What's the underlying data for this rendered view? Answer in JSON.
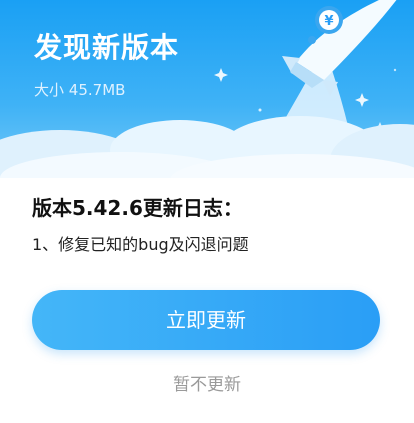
{
  "dialog": {
    "title": "发现新版本",
    "size_label": "大小",
    "size_value": "45.7MB",
    "changelog_title": "版本5.42.6更新日志：",
    "changelog_items": [
      "1、修复已知的bug及闪退问题"
    ],
    "update_button": "立即更新",
    "later_button": "暂不更新"
  },
  "colors": {
    "header_top": "#1aa0f4",
    "accent": "#2a9ef6",
    "later_text": "#9a9a9a"
  },
  "icons": {
    "header_art": "rocket-icon",
    "rocket_emblem": "yen-coin-icon"
  }
}
